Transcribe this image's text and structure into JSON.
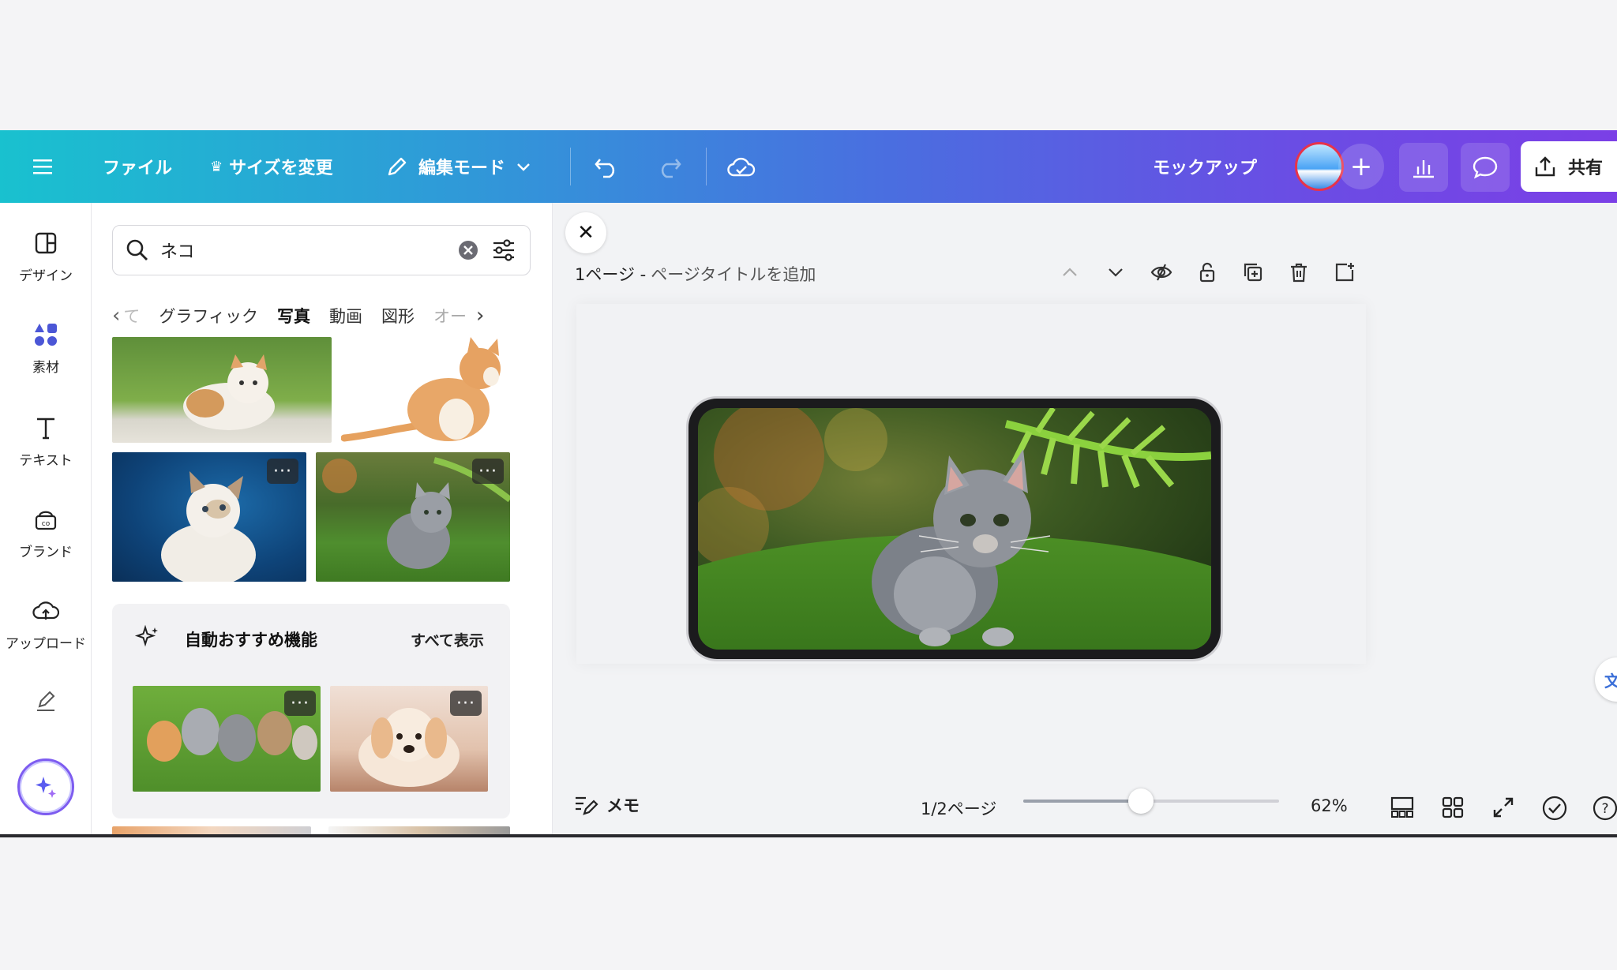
{
  "topbar": {
    "menu_icon": "hamburger-icon",
    "file_label": "ファイル",
    "resize_label": "サイズを変更",
    "edit_mode_label": "編集モード",
    "project_name": "モックアップ",
    "share_label": "共有",
    "add_label": "+"
  },
  "rail": {
    "items": [
      {
        "label": "デザイン",
        "icon": "layout-icon"
      },
      {
        "label": "素材",
        "icon": "shapes-icon"
      },
      {
        "label": "テキスト",
        "icon": "text-icon"
      },
      {
        "label": "ブランド",
        "icon": "brand-icon"
      },
      {
        "label": "アップロード",
        "icon": "upload-icon"
      }
    ]
  },
  "panel": {
    "search_value": "ネコ",
    "tabs": [
      "て",
      "グラフィック",
      "写真",
      "動画",
      "図形",
      "オー"
    ],
    "active_tab": "写真",
    "recommend_title": "自動おすすめ機能",
    "recommend_link": "すべて表示",
    "more_label": "···"
  },
  "canvas": {
    "page_label": "1ページ -",
    "page_title_placeholder": "ページタイトルを追加",
    "memo_label": "メモ",
    "page_count": "1/2ページ",
    "zoom": "62%",
    "zoom_fraction": 0.46,
    "translate_glyph": "文"
  },
  "colors": {
    "accent": "#7d2ae8",
    "topbar_start": "#19c1cf",
    "topbar_end": "#7b3fe6"
  }
}
